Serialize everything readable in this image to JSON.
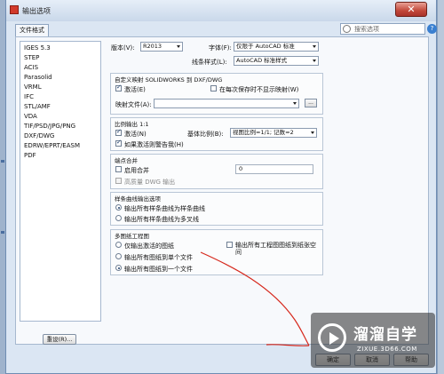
{
  "window": {
    "title": "输出选项",
    "close_glyph": "✕"
  },
  "tab": {
    "label": "文件格式"
  },
  "search": {
    "placeholder": "搜索选项",
    "help_glyph": "?"
  },
  "formats": [
    "IGES 5.3",
    "STEP",
    "ACIS",
    "Parasolid",
    "VRML",
    "IFC",
    "STL/AMF",
    "VDA",
    "TIF/PSD/JPG/PNG",
    "DXF/DWG",
    "EDRW/EPRT/EASM",
    "PDF"
  ],
  "reset_label": "重设(R)...",
  "top": {
    "version_label": "版本(V):",
    "version_value": "R2013",
    "font_label": "字体(F):",
    "font_value": "仅限于 AutoCAD 标准",
    "linestyle_label": "线条样式(L):",
    "linestyle_value": "AutoCAD 标准样式"
  },
  "custom_map": {
    "title": "自定义映射 SOLIDWORKS 到 DXF/DWG",
    "activate_label": "激活(E)",
    "activate_checked": true,
    "no_show_label": "在每次保存时不显示映射(W)",
    "no_show_checked": false,
    "map_file_label": "映射文件(A):",
    "map_file_value": "",
    "browse_label": "..."
  },
  "scale": {
    "title": "比例输出 1:1",
    "activate_label": "激活(N)",
    "activate_checked": true,
    "base_scale_label": "基体比例(B):",
    "base_scale_value": "视图比例=1/1; 记数=2",
    "warn_label": "如果激活则警告我(H)",
    "warn_checked": true
  },
  "merge": {
    "title": "端点合并",
    "enable_label": "启用合并",
    "enable_checked": false,
    "value": "0",
    "hq_label": "高质量 DWG 输出",
    "hq_checked": false
  },
  "spline": {
    "title": "样条曲线输出选项",
    "opt1": "输出所有样条曲线为样条曲线",
    "opt2": "输出所有样条曲线为多叉线",
    "selected": 1
  },
  "sheets": {
    "title": "多图纸工程图",
    "opt1": "仅输出激活的图纸",
    "opt2": "输出所有图纸到单个文件",
    "opt3": "输出所有图纸到一个文件",
    "selected": 3,
    "all_sheets_space_label": "输出所有工程图图纸到纸张空间",
    "all_sheets_space_checked": false
  },
  "buttons": {
    "ok": "确定",
    "cancel": "取消",
    "help": "帮助"
  },
  "watermark": {
    "brand": "溜溜自学",
    "url": "ZIXUE.3D66.COM"
  },
  "colors": {
    "accent": "#3a7fd0",
    "close": "#c2483a",
    "annotation": "#d6281c"
  }
}
